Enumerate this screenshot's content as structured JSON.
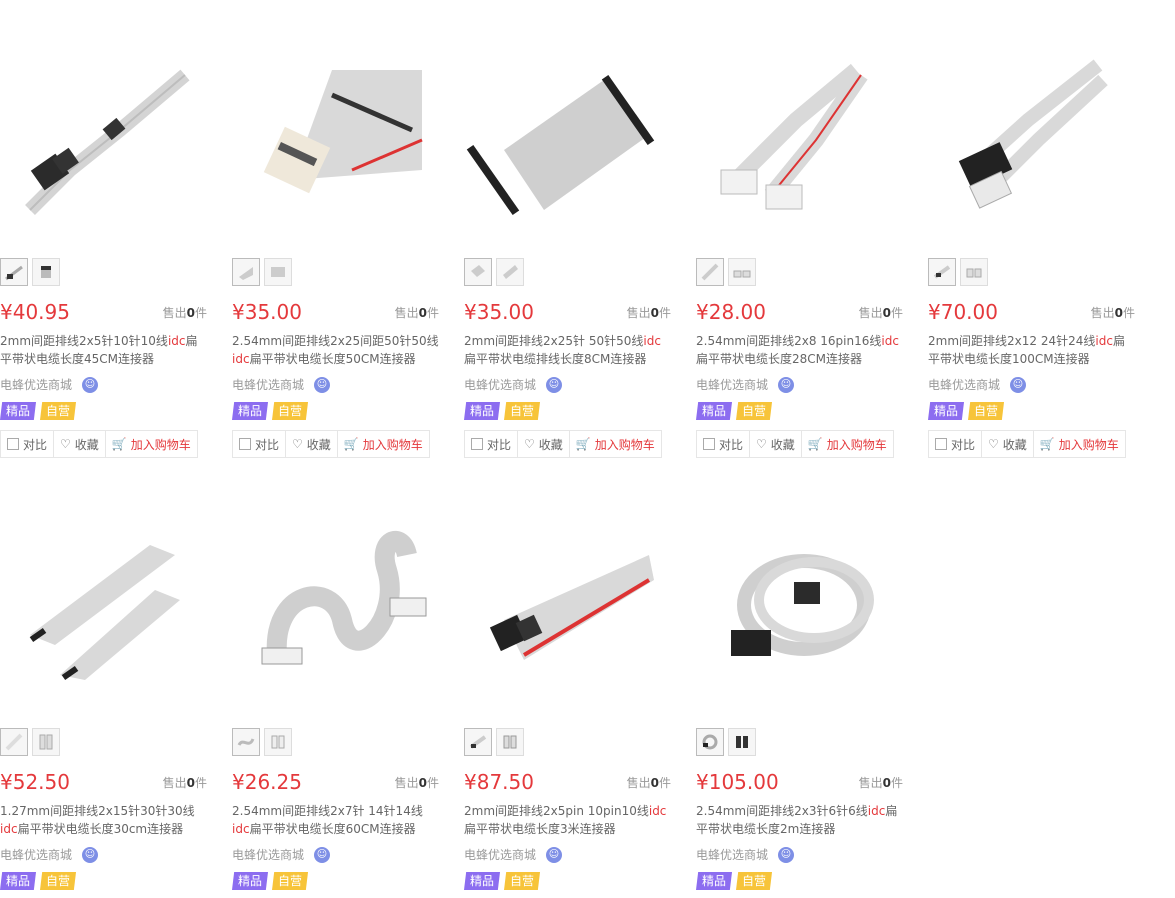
{
  "products": [
    {
      "price": "¥40.95",
      "sold_prefix": "售出",
      "sold_count": "0",
      "sold_unit": "件",
      "title_parts": [
        "2mm间距排线2x5针10针10线",
        "idc",
        "扁平带状电缆长度45CM连接器"
      ],
      "shop": "电蜂优选商城",
      "tags": [
        "精品",
        "自营"
      ],
      "actions": {
        "compare": "对比",
        "fav": "收藏",
        "cart": "加入购物车"
      },
      "icon": "gray-ribbon-cable-image"
    },
    {
      "price": "¥35.00",
      "sold_prefix": "售出",
      "sold_count": "0",
      "sold_unit": "件",
      "title_parts": [
        "2.54mm间距排线2x25间距50针50线",
        "idc",
        "扁平带状电缆长度50CM连接器"
      ],
      "shop": "电蜂优选商城",
      "tags": [
        "精品",
        "自营"
      ],
      "actions": {
        "compare": "对比",
        "fav": "收藏",
        "cart": "加入购物车"
      },
      "icon": "gray-ribbon-cable-image"
    },
    {
      "price": "¥35.00",
      "sold_prefix": "售出",
      "sold_count": "0",
      "sold_unit": "件",
      "title_parts": [
        " 2mm间距排线2x25针 50针50线",
        "idc",
        "扁平带状电缆排线长度8CM连接器"
      ],
      "shop": "电蜂优选商城",
      "tags": [
        "精品",
        "自营"
      ],
      "actions": {
        "compare": "对比",
        "fav": "收藏",
        "cart": "加入购物车"
      },
      "icon": "gray-ribbon-cable-image"
    },
    {
      "price": "¥28.00",
      "sold_prefix": "售出",
      "sold_count": "0",
      "sold_unit": "件",
      "title_parts": [
        "2.54mm间距排线2x8 16pin16线",
        "idc",
        "扁平带状电缆长度28CM连接器"
      ],
      "shop": "电蜂优选商城",
      "tags": [
        "精品",
        "自营"
      ],
      "actions": {
        "compare": "对比",
        "fav": "收藏",
        "cart": "加入购物车"
      },
      "icon": "gray-ribbon-cable-image"
    },
    {
      "price": "¥70.00",
      "sold_prefix": "售出",
      "sold_count": "0",
      "sold_unit": "件",
      "title_parts": [
        "2mm间距排线2x12 24针24线",
        "idc",
        "扁平带状电缆长度100CM连接器"
      ],
      "shop": "电蜂优选商城",
      "tags": [
        "精品",
        "自营"
      ],
      "actions": {
        "compare": "对比",
        "fav": "收藏",
        "cart": "加入购物车"
      },
      "icon": "gray-ribbon-cable-image"
    },
    {
      "price": "¥52.50",
      "sold_prefix": "售出",
      "sold_count": "0",
      "sold_unit": "件",
      "title_parts": [
        "1.27mm间距排线2x15针30针30线",
        "idc",
        "扁平带状电缆长度30cm连接器"
      ],
      "shop": "电蜂优选商城",
      "tags": [
        "精品",
        "自营"
      ],
      "icon": "gray-ribbon-cable-image"
    },
    {
      "price": "¥26.25",
      "sold_prefix": "售出",
      "sold_count": "0",
      "sold_unit": "件",
      "title_parts": [
        "2.54mm间距排线2x7针 14针14线",
        "idc",
        "扁平带状电缆长度60CM连接器"
      ],
      "shop": "电蜂优选商城",
      "tags": [
        "精品",
        "自营"
      ],
      "icon": "gray-ribbon-cable-image"
    },
    {
      "price": "¥87.50",
      "sold_prefix": "售出",
      "sold_count": "0",
      "sold_unit": "件",
      "title_parts": [
        "2mm间距排线2x5pin 10pin10线",
        "idc",
        "扁平带状电缆长度3米连接器"
      ],
      "shop": "电蜂优选商城",
      "tags": [
        "精品",
        "自营"
      ],
      "icon": "gray-ribbon-cable-image"
    },
    {
      "price": "¥105.00",
      "sold_prefix": "售出",
      "sold_count": "0",
      "sold_unit": "件",
      "title_parts": [
        "2.54mm间距排线2x3针6针6线",
        "idc",
        "扁平带状电缆长度2m连接器"
      ],
      "shop": "电蜂优选商城",
      "tags": [
        "精品",
        "自营"
      ],
      "icon": "gray-ribbon-cable-image"
    }
  ]
}
